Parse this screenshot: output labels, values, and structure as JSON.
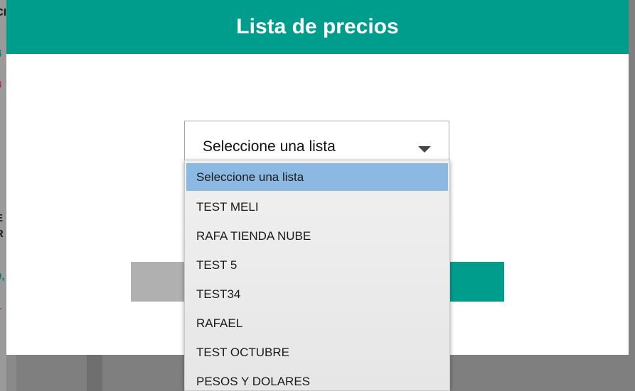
{
  "modal": {
    "title": "Lista de precios",
    "select": {
      "value": "Seleccione una lista"
    },
    "options": [
      "Seleccione una lista",
      "TEST MELI",
      "RAFA TIENDA NUBE",
      "TEST 5",
      "TEST34",
      "RAFAEL",
      "TEST OCTUBRE",
      "PESOS Y DOLARES"
    ],
    "selected_index": 0
  },
  "background_fragments": [
    "CI",
    "4",
    "8",
    "E",
    "R",
    "0,",
    "1"
  ],
  "colors": {
    "header": "#009d8d",
    "selected_option": "#8cb9e2",
    "cancel": "#b0b0b0",
    "accept": "#009d8d"
  }
}
